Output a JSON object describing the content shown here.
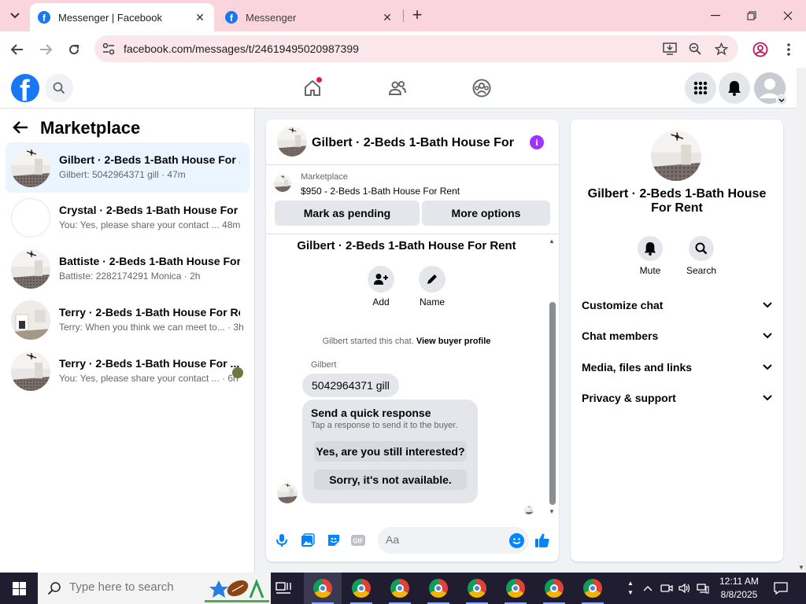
{
  "browser": {
    "tabs": [
      {
        "title": "Messenger | Facebook",
        "active": true
      },
      {
        "title": "Messenger",
        "active": false
      }
    ],
    "url": "facebook.com/messages/t/24619495020987399"
  },
  "left_panel": {
    "title": "Marketplace",
    "conversations": [
      {
        "title": "Gilbert · 2-Beds 1-Bath House For ...",
        "subtitle": "Gilbert: 5042964371 gill · 47m",
        "selected": true
      },
      {
        "title": "Crystal · 2-Beds 1-Bath House For ...",
        "subtitle": "You: Yes, please share your contact ...  48m",
        "selected": false
      },
      {
        "title": "Battiste · 2-Beds 1-Bath House For ...",
        "subtitle": "Battiste: 2282174291 Monica · 2h",
        "selected": false
      },
      {
        "title": "Terry · 2-Beds 1-Bath House For Re...",
        "subtitle": "Terry: When you think we can meet to... · 3h",
        "selected": false
      },
      {
        "title": "Terry · 2-Beds 1-Bath House For ...",
        "subtitle": "You: Yes, please share your contact ... · 6h",
        "selected": false
      }
    ]
  },
  "chat": {
    "header_title": "Gilbert · 2-Beds 1-Bath House For R...",
    "marketplace_label": "Marketplace",
    "listing": "$950 - 2-Beds 1-Bath House For Rent",
    "mark_pending": "Mark as pending",
    "more_options": "More options",
    "body_title": "Gilbert · 2-Beds 1-Bath House For Rent",
    "actions": [
      {
        "label": "Add"
      },
      {
        "label": "Name"
      }
    ],
    "started_text": "Gilbert started this chat.",
    "view_buyer": "View buyer profile",
    "sender_name": "Gilbert",
    "message": "5042964371 gill",
    "quick_response": {
      "title": "Send a quick response",
      "subtitle": "Tap a response to send it to the buyer.",
      "options": [
        "Yes, are you still interested?",
        "Sorry, it's not available."
      ]
    },
    "composer_placeholder": "Aa"
  },
  "right_panel": {
    "title": "Gilbert · 2-Beds 1-Bath House For Rent",
    "actions": [
      {
        "label": "Mute"
      },
      {
        "label": "Search"
      }
    ],
    "sections": [
      "Customize chat",
      "Chat members",
      "Media, files and links",
      "Privacy & support"
    ]
  },
  "taskbar": {
    "search_placeholder": "Type here to search",
    "time": "12:11 AM",
    "date": "8/8/2025"
  },
  "colors": {
    "facebook_blue": "#1877f2",
    "messenger_purple": "#a033ff",
    "tab_strip": "#fbd5dd",
    "selected_row": "#ebf5ff"
  }
}
